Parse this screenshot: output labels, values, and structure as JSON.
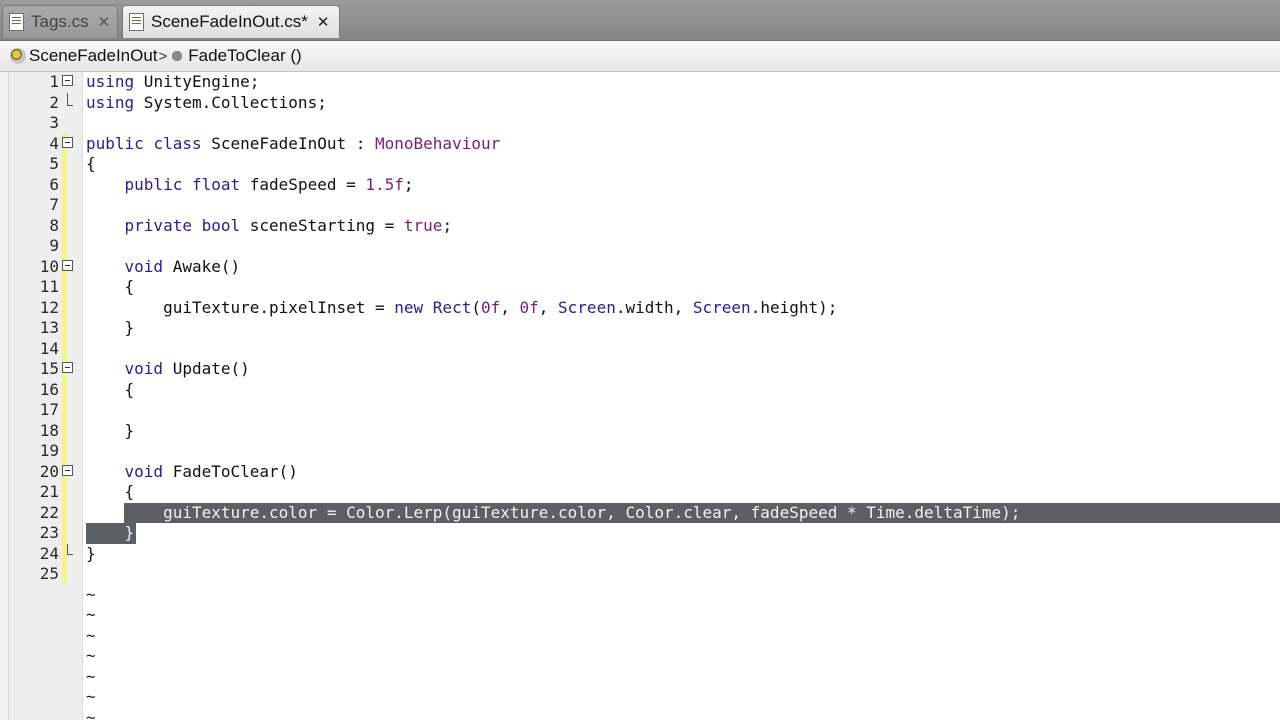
{
  "tabs": [
    {
      "label": "Tags.cs",
      "active": false
    },
    {
      "label": "SceneFadeInOut.cs*",
      "active": true
    }
  ],
  "breadcrumb": {
    "class_name": "SceneFadeInOut",
    "separator": ">",
    "method_name": "FadeToClear ()"
  },
  "editor": {
    "lines": [
      {
        "n": "1",
        "text": "using UnityEngine;"
      },
      {
        "n": "2",
        "text": "using System.Collections;"
      },
      {
        "n": "3",
        "text": ""
      },
      {
        "n": "4",
        "text": "public class SceneFadeInOut : MonoBehaviour"
      },
      {
        "n": "5",
        "text": "{"
      },
      {
        "n": "6",
        "text": "    public float fadeSpeed = 1.5f;"
      },
      {
        "n": "7",
        "text": ""
      },
      {
        "n": "8",
        "text": "    private bool sceneStarting = true;"
      },
      {
        "n": "9",
        "text": ""
      },
      {
        "n": "10",
        "text": "    void Awake()"
      },
      {
        "n": "11",
        "text": "    {"
      },
      {
        "n": "12",
        "text": "        guiTexture.pixelInset = new Rect(0f, 0f, Screen.width, Screen.height);"
      },
      {
        "n": "13",
        "text": "    }"
      },
      {
        "n": "14",
        "text": ""
      },
      {
        "n": "15",
        "text": "    void Update()"
      },
      {
        "n": "16",
        "text": "    {"
      },
      {
        "n": "17",
        "text": ""
      },
      {
        "n": "18",
        "text": "    }"
      },
      {
        "n": "19",
        "text": ""
      },
      {
        "n": "20",
        "text": "    void FadeToClear()"
      },
      {
        "n": "21",
        "text": "    {"
      },
      {
        "n": "22",
        "text": "        guiTexture.color = Color.Lerp(guiTexture.color, Color.clear, fadeSpeed * Time.deltaTime);"
      },
      {
        "n": "23",
        "text": "    }"
      },
      {
        "n": "24",
        "text": "}"
      },
      {
        "n": "25",
        "text": ""
      }
    ],
    "empty_marker": "~",
    "selected_lines": [
      "22",
      "23"
    ]
  },
  "colors": {
    "keyword": "#2c1b94",
    "literal": "#7a1e7a",
    "selection": "#5c5f63",
    "change_bar": "#f2f58a"
  }
}
